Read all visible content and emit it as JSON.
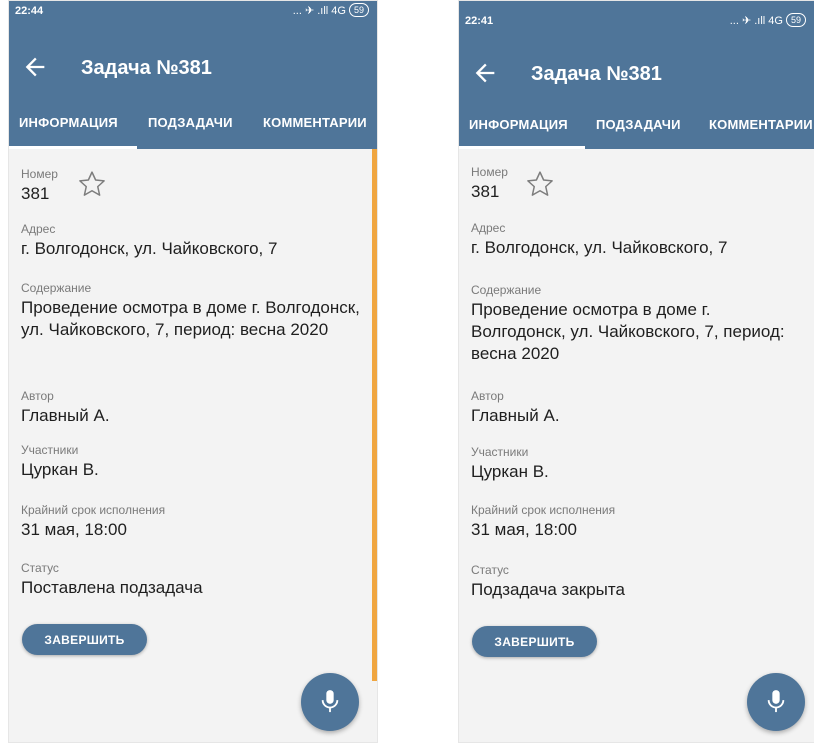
{
  "left": {
    "status_bar": {
      "time": "22:44",
      "icons": "... ✈ .ıll 4G",
      "battery": "59"
    },
    "toolbar": {
      "title": "Задача №381"
    },
    "tabs": [
      "ИНФОРМАЦИЯ",
      "ПОДЗАДАЧИ",
      "КОММЕНТАРИИ"
    ],
    "fields": {
      "number_label": "Номер",
      "number_value": "381",
      "address_label": "Адрес",
      "address_value": "г. Волгодонск, ул. Чайковского, 7",
      "content_label": "Содержание",
      "content_value": "Проведение осмотра в доме г. Волгодонск, ул. Чайковского, 7, период: весна 2020",
      "author_label": "Автор",
      "author_value": "Главный А.",
      "participants_label": "Участники",
      "participants_value": "Цуркан В.",
      "deadline_label": "Крайний срок исполнения",
      "deadline_value": "31 мая, 18:00",
      "status_label": "Статус",
      "status_value": "Поставлена подзадача"
    },
    "finish_button": "ЗАВЕРШИТЬ"
  },
  "right": {
    "status_bar": {
      "time": "22:41",
      "icons": "... ✈ .ıll 4G",
      "battery": "59"
    },
    "toolbar": {
      "title": "Задача №381"
    },
    "tabs": [
      "ИНФОРМАЦИЯ",
      "ПОДЗАДАЧИ",
      "КОММЕНТАРИИ"
    ],
    "fields": {
      "number_label": "Номер",
      "number_value": "381",
      "address_label": "Адрес",
      "address_value": "г. Волгодонск, ул. Чайковского, 7",
      "content_label": "Содержание",
      "content_value": "Проведение осмотра в доме г. Волгодонск, ул. Чайковского, 7, период: весна 2020",
      "author_label": "Автор",
      "author_value": "Главный А.",
      "participants_label": "Участники",
      "participants_value": "Цуркан В.",
      "deadline_label": "Крайний срок исполнения",
      "deadline_value": "31 мая, 18:00",
      "status_label": "Статус",
      "status_value": "Подзадача закрыта"
    },
    "finish_button": "ЗАВЕРШИТЬ"
  },
  "colors": {
    "primary": "#4f7599",
    "scroll_accent": "#f0a640",
    "background": "#f3f3f3"
  },
  "icons": {
    "back": "arrow-left-icon",
    "favorite": "star-outline-icon",
    "voice": "microphone-icon"
  }
}
